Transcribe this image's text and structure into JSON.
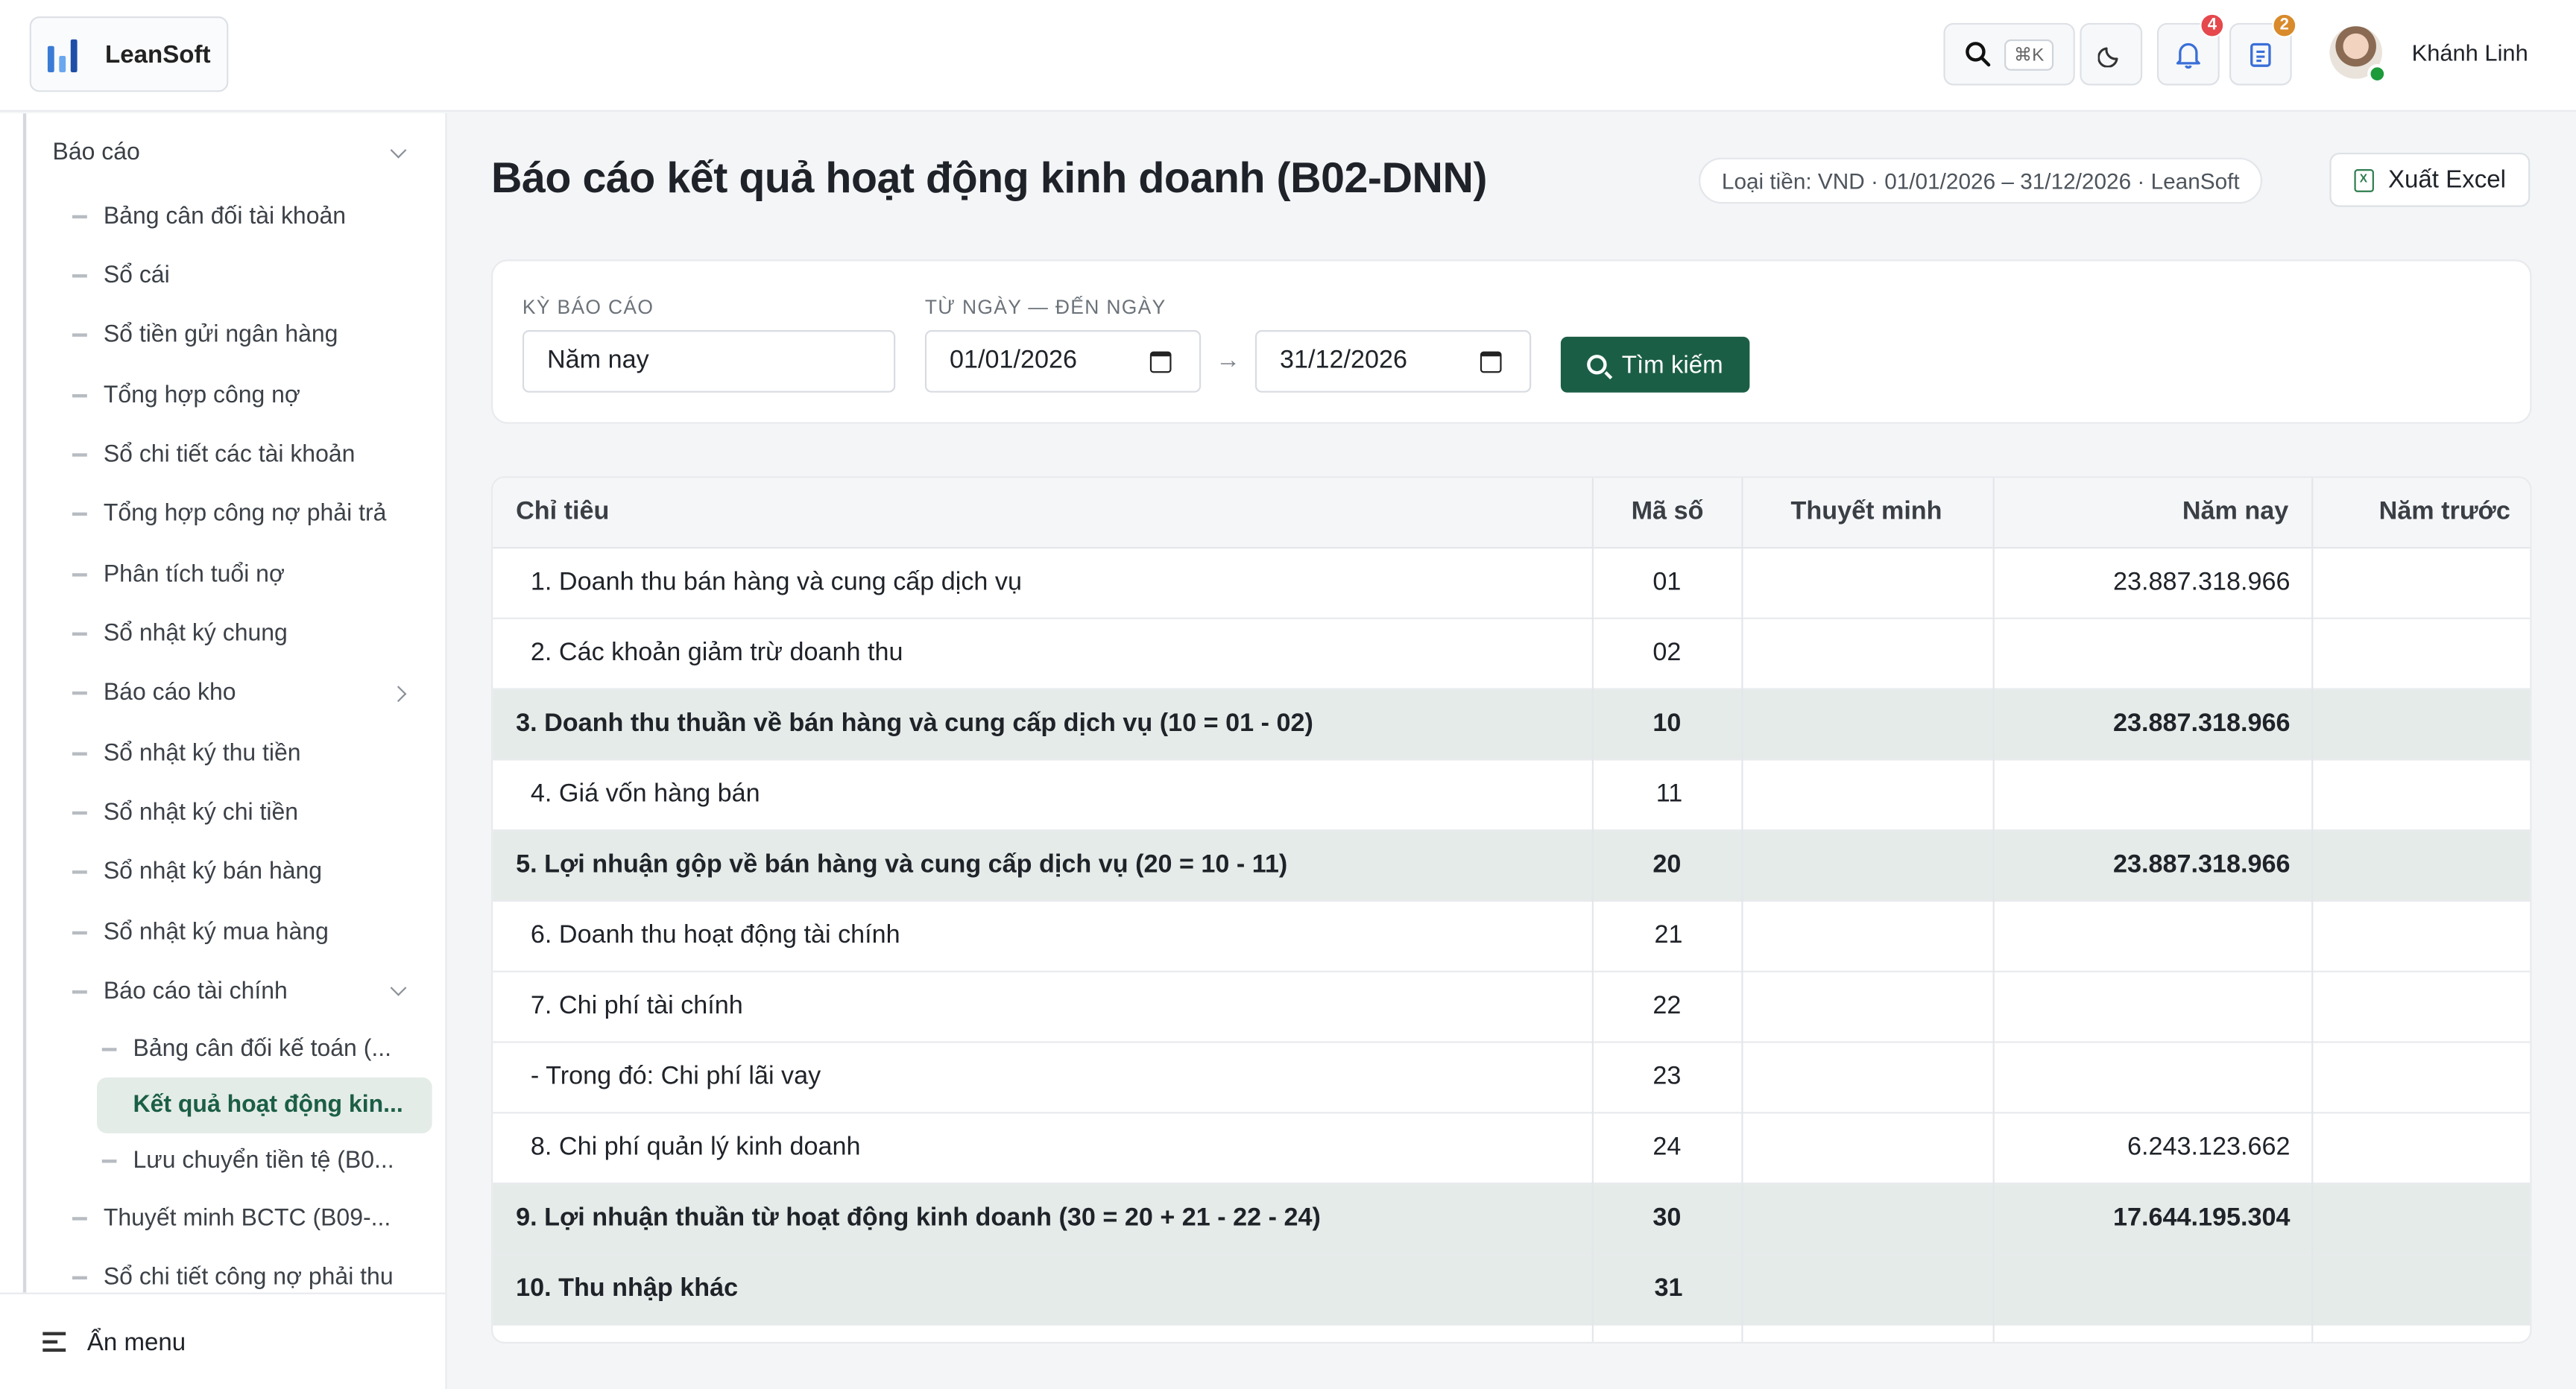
{
  "brand": {
    "name": "LeanSoft",
    "logo_colors": [
      "#3a7bd5",
      "#6aa7ef",
      "#1e4fa8"
    ]
  },
  "header": {
    "search_shortcut": "⌘K",
    "notification_count": "4",
    "tasks_count": "2",
    "user_name": "Khánh Linh",
    "colors": {
      "notification_badge": "#e5484d",
      "tasks_badge": "#d98a2b"
    }
  },
  "sidebar": {
    "section_title": "Báo cáo",
    "items": [
      "Bảng cân đối tài khoản",
      "Sổ cái",
      "Sổ tiền gửi ngân hàng",
      "Tổng hợp công nợ",
      "Sổ chi tiết các tài khoản",
      "Tổng hợp công nợ phải trả",
      "Phân tích tuổi nợ",
      "Sổ nhật ký chung",
      "Báo cáo kho",
      "Sổ nhật ký thu tiền",
      "Sổ nhật ký chi tiền",
      "Sổ nhật ký bán hàng",
      "Sổ nhật ký mua hàng",
      "Báo cáo tài chính"
    ],
    "sub_items": [
      "Bảng cân đối kế toán (...",
      "Kết quả hoạt động kin...",
      "Lưu chuyển tiền tệ (B0..."
    ],
    "items_after": [
      "Thuyết minh BCTC (B09-...",
      "Sổ chi tiết công nợ phải thu"
    ],
    "hide_menu_label": "Ẩn menu",
    "active_color": "#1b5e46"
  },
  "main": {
    "title": "Báo cáo kết quả hoạt động kinh doanh (B02-DNN)",
    "meta": "Loại tiền: VND · 01/01/2026 – 31/12/2026 · LeanSoft",
    "export_label": "Xuất Excel",
    "filters": {
      "period_label": "KỲ BÁO CÁO",
      "period_value": "Năm nay",
      "range_label": "TỪ NGÀY — ĐẾN NGÀY",
      "from_date": "01/01/2026",
      "to_date": "31/12/2026",
      "search_label": "Tìm kiếm"
    },
    "table": {
      "headers": [
        "Chỉ tiêu",
        "Mã số",
        "Thuyết minh",
        "Năm nay",
        "Năm trước"
      ],
      "rows": [
        {
          "label": "1. Doanh thu bán hàng và cung cấp dịch vụ",
          "code": "01",
          "note": "",
          "current": "23.887.318.966",
          "previous": ""
        },
        {
          "label": "2. Các khoản giảm trừ doanh thu",
          "code": "02",
          "note": "",
          "current": "",
          "previous": ""
        },
        {
          "label": "3. Doanh thu thuần về bán hàng và cung cấp dịch vụ (10 = 01 - 02)",
          "code": "10",
          "note": "",
          "current": "23.887.318.966",
          "previous": ""
        },
        {
          "label": "4. Giá vốn hàng bán",
          "code": "11",
          "note": "",
          "current": "",
          "previous": ""
        },
        {
          "label": "5. Lợi nhuận gộp về bán hàng và cung cấp dịch vụ (20 = 10 - 11)",
          "code": "20",
          "note": "",
          "current": "23.887.318.966",
          "previous": ""
        },
        {
          "label": "6. Doanh thu hoạt động tài chính",
          "code": "21",
          "note": "",
          "current": "",
          "previous": ""
        },
        {
          "label": "7. Chi phí tài chính",
          "code": "22",
          "note": "",
          "current": "",
          "previous": ""
        },
        {
          "label": "- Trong đó: Chi phí lãi vay",
          "code": "23",
          "note": "",
          "current": "",
          "previous": ""
        },
        {
          "label": "8. Chi phí quản lý kinh doanh",
          "code": "24",
          "note": "",
          "current": "6.243.123.662",
          "previous": ""
        },
        {
          "label": "9. Lợi nhuận thuần từ hoạt động kinh doanh (30 = 20 + 21 - 22 - 24)",
          "code": "30",
          "note": "",
          "current": "17.644.195.304",
          "previous": ""
        },
        {
          "label": "10. Thu nhập khác",
          "code": "31",
          "note": "",
          "current": "",
          "previous": ""
        }
      ]
    }
  }
}
